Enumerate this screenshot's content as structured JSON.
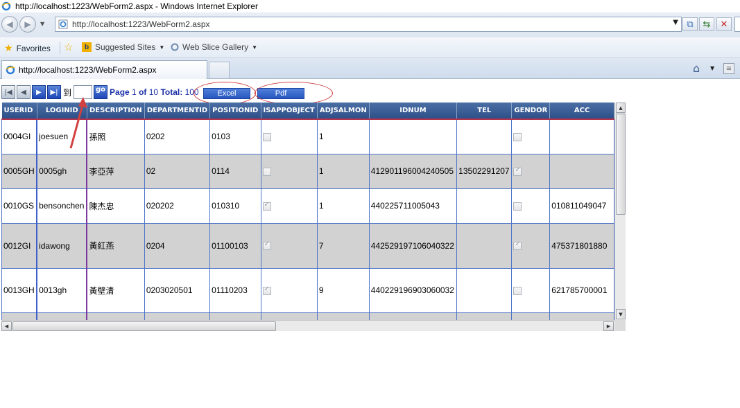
{
  "window": {
    "title": "http://localhost:1223/WebForm2.aspx - Windows Internet Explorer"
  },
  "address_bar": {
    "url": "http://localhost:1223/WebForm2.aspx"
  },
  "favorites_bar": {
    "favorites_label": "Favorites",
    "suggested_sites_label": "Suggested Sites",
    "web_slice_gallery_label": "Web Slice Gallery"
  },
  "tabs": [
    {
      "label": "http://localhost:1223/WebForm2.aspx"
    }
  ],
  "pager": {
    "to_label": "到",
    "go_label": "go",
    "page_label": "Page",
    "current_page": "1",
    "of_label": "of",
    "total_pages": "10",
    "total_label": "Total:",
    "total_count": "100"
  },
  "export": {
    "excel_label": "Excel",
    "pdf_label": "Pdf"
  },
  "grid": {
    "columns": [
      {
        "label": "USERID"
      },
      {
        "label": "LOGINID"
      },
      {
        "label": "DESCRIPTION"
      },
      {
        "label": "DEPARTMENTID"
      },
      {
        "label": "POSITIONID"
      },
      {
        "label": "ISAPPOBJECT"
      },
      {
        "label": "ADJSALMON"
      },
      {
        "label": "IDNUM"
      },
      {
        "label": "TEL"
      },
      {
        "label": "GENDOR"
      },
      {
        "label": "ACC"
      }
    ],
    "rows": [
      {
        "userid": "0004GI",
        "loginid": "joesuen",
        "description": "孫照",
        "departmentid": "0202",
        "positionid": "0103",
        "isappobject": false,
        "adjsalmon": "1",
        "idnum": "",
        "tel": "",
        "gendor": false,
        "acc": ""
      },
      {
        "userid": "0005GH",
        "loginid": "0005gh",
        "description": "李亞萍",
        "departmentid": "02",
        "positionid": "0114",
        "isappobject": false,
        "adjsalmon": "1",
        "idnum": "412901196004240505",
        "tel": "13502291207",
        "gendor": true,
        "acc": ""
      },
      {
        "userid": "0010GS",
        "loginid": "bensonchen",
        "description": "陳杰忠",
        "departmentid": "020202",
        "positionid": "010310",
        "isappobject": true,
        "adjsalmon": "1",
        "idnum": "440225711005043",
        "tel": "",
        "gendor": false,
        "acc": "010811049047"
      },
      {
        "userid": "0012GI",
        "loginid": "idawong",
        "description": "黃紅燕",
        "departmentid": "0204",
        "positionid": "01100103",
        "isappobject": true,
        "adjsalmon": "7",
        "idnum": "442529197106040322",
        "tel": "",
        "gendor": true,
        "acc": "475371801880"
      },
      {
        "userid": "0013GH",
        "loginid": "0013gh",
        "description": "黃壁清",
        "departmentid": "0203020501",
        "positionid": "01110203",
        "isappobject": true,
        "adjsalmon": "9",
        "idnum": "440229196903060032",
        "tel": "",
        "gendor": false,
        "acc": "621785700001"
      }
    ]
  },
  "colors": {
    "header_bg": "#2d5088",
    "header_bottom_border": "#b0304a",
    "cell_border": "#4e74c9",
    "alt_row_bg": "#d2d2d2",
    "pager_text": "#1a2fa8",
    "export_button_bg": "#2857c0",
    "annotation_red": "#d24040"
  }
}
